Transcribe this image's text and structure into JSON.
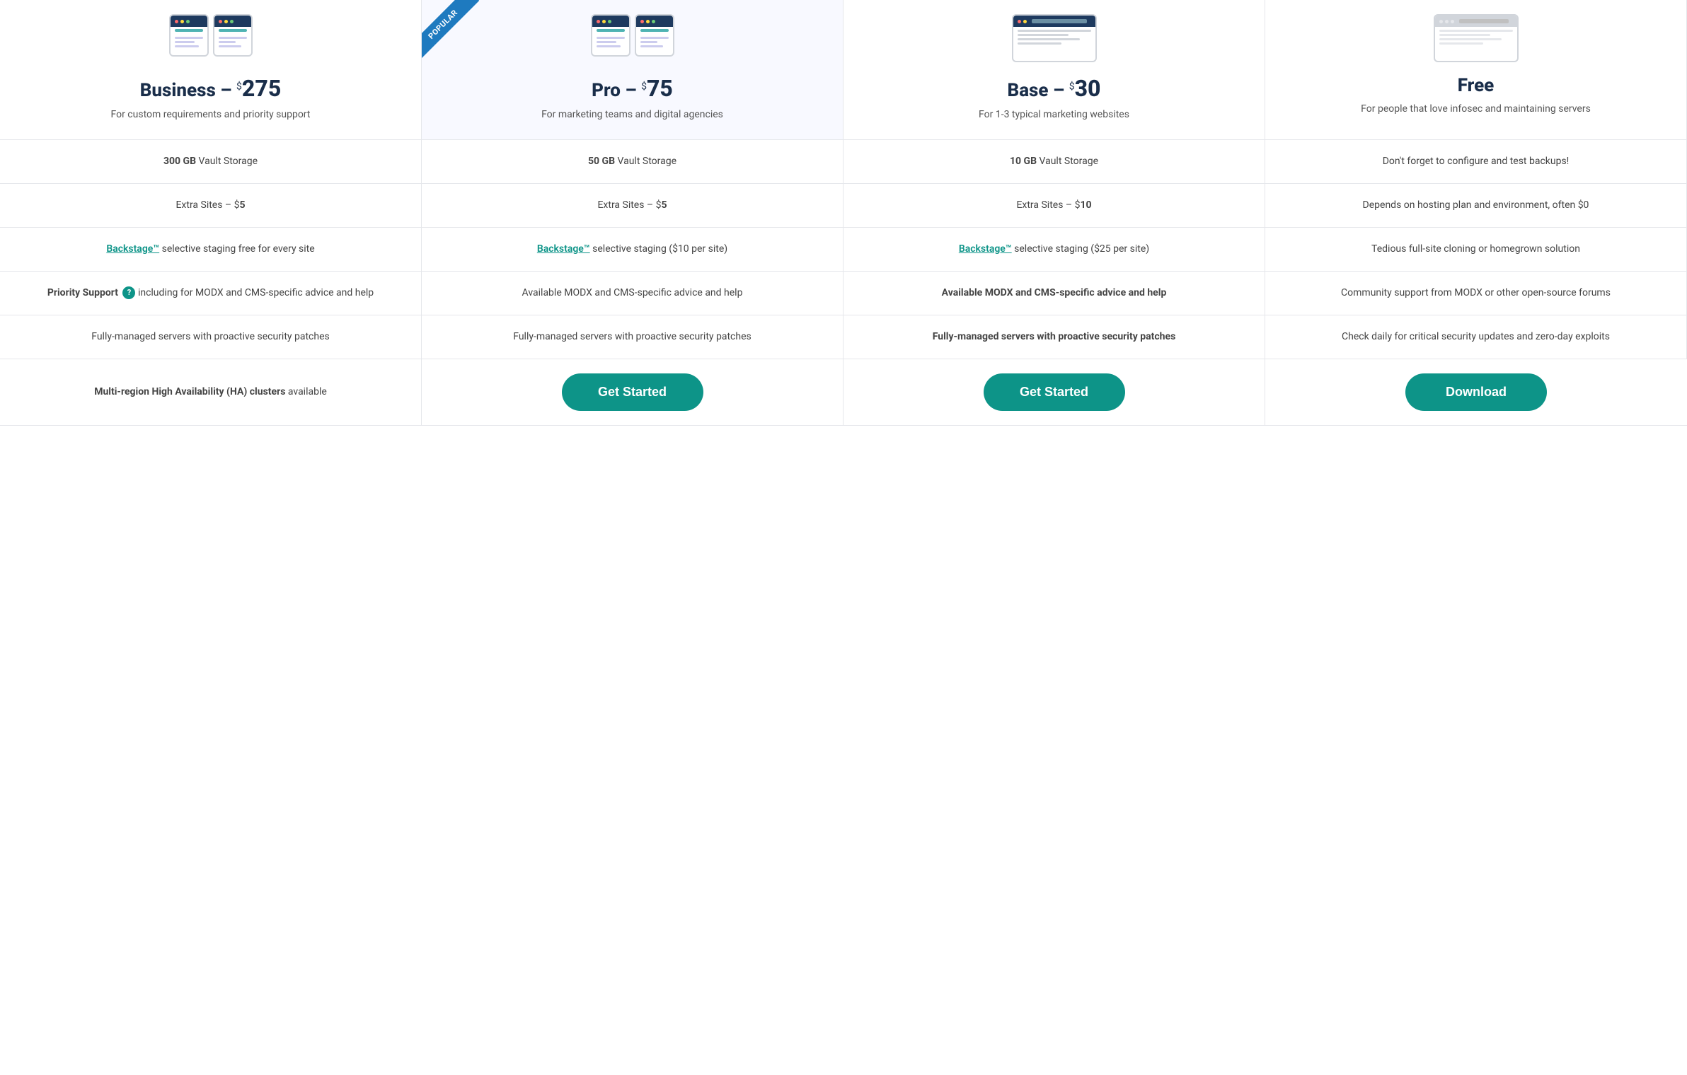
{
  "plans": [
    {
      "id": "business",
      "name": "Business",
      "price": "275",
      "description": "For custom requirements and priority support",
      "popular": false,
      "browserClass": "browser-business",
      "isTwoBrowsers": true
    },
    {
      "id": "pro",
      "name": "Pro",
      "price": "75",
      "description": "For marketing teams and digital agencies",
      "popular": true,
      "popularLabel": "POPULAR",
      "browserClass": "browser-pro",
      "isTwoBrowsers": true
    },
    {
      "id": "base",
      "name": "Base",
      "price": "30",
      "description": "For 1-3 typical marketing websites",
      "popular": false,
      "browserClass": "browser-base",
      "isTwoBrowsers": false
    },
    {
      "id": "free",
      "name": "Free",
      "price": null,
      "description": "For people that love infosec and maintaining servers",
      "popular": false,
      "browserClass": "browser-free",
      "isTwoBrowsers": false
    }
  ],
  "rows": [
    {
      "cells": [
        "<strong>300 GB</strong> Vault Storage",
        "<strong>50 GB</strong> Vault Storage",
        "<strong>10 GB</strong> Vault Storage",
        "Don't forget to configure and test backups!"
      ]
    },
    {
      "cells": [
        "Extra Sites – $<strong>5</strong>",
        "Extra Sites – $<strong>5</strong>",
        "Extra Sites – $<strong>10</strong>",
        "Depends on hosting plan and environment, often $0"
      ]
    },
    {
      "cells": [
        "<a class=\"backstage-link\">Backstage™</a> selective staging free for every site",
        "<a class=\"backstage-link\">Backstage™</a> selective staging ($10 per site)",
        "<a class=\"backstage-link\">Backstage™</a> selective staging ($25 per site)",
        "Tedious full-site cloning or homegrown solution"
      ]
    },
    {
      "cells": [
        "<strong>Priority Support</strong> <span class=\"help-icon\">?</span> including for MODX and CMS-specific advice and help",
        "Available MODX and CMS-specific advice and help",
        "<strong>Available MODX and CMS-specific advice and help</strong>",
        "Community support from MODX or other open-source forums"
      ]
    },
    {
      "cells": [
        "Fully-managed servers with proactive security patches",
        "Fully-managed servers with proactive security patches",
        "<strong>Fully-managed servers with proactive security patches</strong>",
        "Check daily for critical security updates and zero-day exploits"
      ]
    },
    {
      "cells": [
        "<strong>Multi-region High Availability (HA) clusters</strong> available",
        "button:Get Started",
        "button:Get Started",
        "button:Download"
      ]
    }
  ],
  "buttons": {
    "get_started": "Get Started",
    "download": "Download"
  }
}
